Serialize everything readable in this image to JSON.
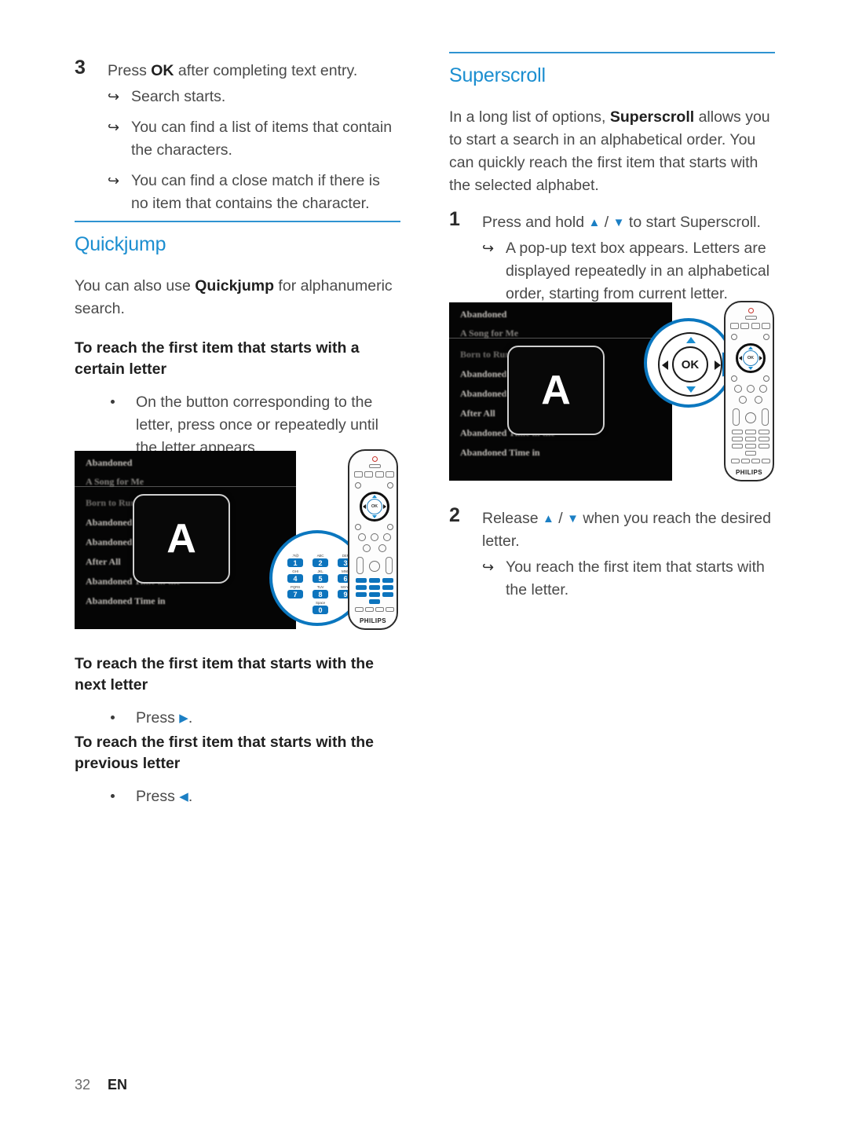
{
  "page": {
    "number": "32",
    "language": "EN"
  },
  "colors": {
    "heading_blue": "#1b8ed0",
    "rule_blue": "#2f93d1",
    "callout_blue": "#0b77bf",
    "key_blue": "#0d74bd",
    "body_gray": "#4a4a4a"
  },
  "left_column": {
    "step3": {
      "number": "3",
      "text_prefix": "Press ",
      "text_bold": "OK",
      "text_suffix": " after completing text entry.",
      "subs": [
        "Search starts.",
        "You can find a list of items that contain the characters.",
        "You can find a close match if there is no item that contains the character."
      ]
    },
    "quickjump": {
      "title": "Quickjump",
      "intro_prefix": "You can also use ",
      "intro_bold": "Quickjump",
      "intro_suffix": " for alphanumeric search.",
      "subhead_certain": "To reach the first item that starts with a certain letter",
      "bullet_certain": "On the button corresponding to the letter, press once or repeatedly until the letter appears.",
      "subhead_next": "To reach the first item that starts with the next letter",
      "bullet_next_prefix": "Press ",
      "bullet_next_icon": "▶",
      "bullet_next_suffix": ".",
      "subhead_previous": "To reach the first item that starts with the previous letter",
      "bullet_prev_prefix": "Press ",
      "bullet_prev_icon": "◀",
      "bullet_prev_suffix": "."
    },
    "figure": {
      "tv_list": [
        "Abandoned",
        "A Song for Me",
        "Born to Run",
        "Abandoned Dream",
        "Abandoned in the 80's",
        "After All",
        "Abandoned Time in the",
        "Abandoned Time in"
      ],
      "popup_letter": "A",
      "keypad": {
        "keys": [
          "1",
          "2",
          "3",
          "4",
          "5",
          "6",
          "7",
          "8",
          "9",
          "0"
        ],
        "labels": [
          ".?!@",
          "ABC",
          "DEF",
          "GHI",
          "JKL",
          "MNO",
          "PQRS",
          "TUV",
          "WXYZ",
          "Space"
        ]
      },
      "remote_brand": "PHILIPS"
    }
  },
  "right_column": {
    "superscroll": {
      "title": "Superscroll",
      "intro_prefix": "In a long list of options, ",
      "intro_bold": "Superscroll",
      "intro_suffix": " allows you to start a search in an alphabetical order. You can quickly reach the first item that starts with the selected alphabet."
    },
    "step1": {
      "number": "1",
      "text_prefix": "Press and hold ",
      "icon_up": "▲",
      "text_mid": " / ",
      "icon_down": "▼",
      "text_suffix": " to start Superscroll.",
      "sub": "A pop-up text box appears. Letters are displayed repeatedly in an alphabetical order, starting from current letter."
    },
    "step2": {
      "number": "2",
      "text_prefix": "Release ",
      "icon_up": "▲",
      "text_mid": " / ",
      "icon_down": "▼",
      "text_suffix": " when you reach the desired letter.",
      "sub": "You reach the first item that starts with the letter."
    },
    "figure": {
      "tv_list": [
        "Abandoned",
        "A Song for Me",
        "Born to Run",
        "Abandoned Dream",
        "Abandoned in the 80's",
        "After All",
        "Abandoned Time in the",
        "Abandoned Time in"
      ],
      "popup_letter": "A",
      "navpad": {
        "ok_label": "OK",
        "up": "▲",
        "down": "▼",
        "left": "◀",
        "right": "▶"
      },
      "remote_brand": "PHILIPS"
    }
  }
}
